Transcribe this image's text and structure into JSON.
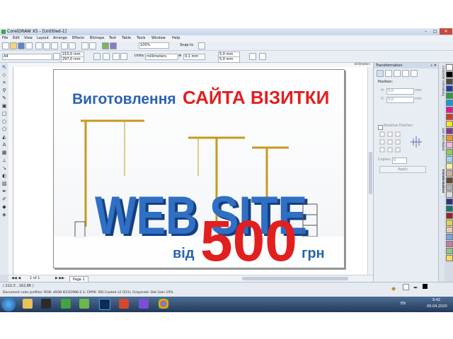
{
  "window": {
    "title": "CorelDRAW X5 - [Untitled-1]"
  },
  "menu": [
    "File",
    "Edit",
    "View",
    "Layout",
    "Arrange",
    "Effects",
    "Bitmaps",
    "Text",
    "Table",
    "Tools",
    "Window",
    "Help"
  ],
  "toolbar": {
    "zoom": "100%",
    "snap_to": "Snap to"
  },
  "property_bar": {
    "page_size": "A4",
    "width": "210,0 mm",
    "height": "297,0 mm",
    "units_label": "Units:",
    "units": "millimeters",
    "nudge": "0,1 mm",
    "dup_x": "5,0 mm",
    "dup_y": "5,0 mm"
  },
  "ruler": {
    "unit": "millimeters"
  },
  "docker": {
    "title": "Transformation",
    "position_label": "Position:",
    "h_value": "0,0",
    "v_value": "0,0",
    "unit": "mm",
    "relative_position": "Relative Position",
    "copies_label": "Copies:",
    "copies_value": "0",
    "apply": "Apply",
    "tabs": [
      "Character Formatting",
      "Size and Repeat",
      "Transformation"
    ]
  },
  "page_tab": {
    "nav": "1 of 1",
    "label": "Page 1"
  },
  "flyer": {
    "heading_blue": "Виготовлення",
    "heading_red": "САЙТА ВІЗИТКИ",
    "big_word": "WEB SITE",
    "price_prefix": "від",
    "price": "500",
    "currency": "грн",
    "colors": {
      "blue": "#2a63b0",
      "red": "#e21f1f",
      "letter_blue": "#2f6fc4"
    }
  },
  "status": {
    "coords": "( 222,3 , 162,86 )",
    "line2": "Document color profiles: RGB: sRGB IEC61966-2.1; CMYK: ISO Coated v2 (ECI); Grayscale: Dot Gain 15%"
  },
  "taskbar": {
    "lang": "EN",
    "time": "9:42",
    "date": "09.04.2020"
  }
}
